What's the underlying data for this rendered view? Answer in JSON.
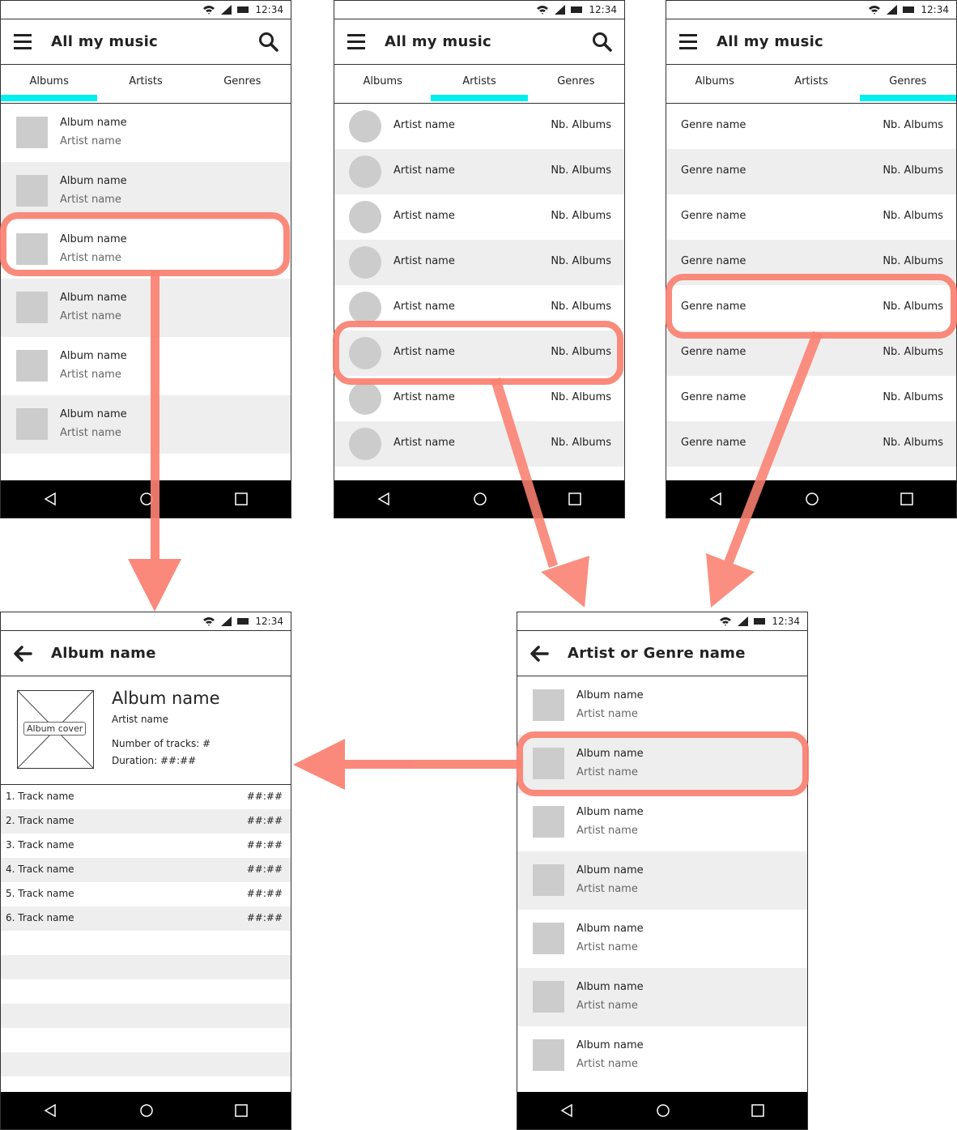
{
  "status": {
    "time": "12:34"
  },
  "screen_albums": {
    "title": "All my music",
    "tabs": [
      "Albums",
      "Artists",
      "Genres"
    ],
    "items": [
      {
        "album": "Album name",
        "artist": "Artist name"
      },
      {
        "album": "Album name",
        "artist": "Artist name"
      },
      {
        "album": "Album name",
        "artist": "Artist name"
      },
      {
        "album": "Album name",
        "artist": "Artist name"
      },
      {
        "album": "Album name",
        "artist": "Artist name"
      },
      {
        "album": "Album name",
        "artist": "Artist name"
      }
    ]
  },
  "screen_artists": {
    "title": "All my music",
    "tabs": [
      "Albums",
      "Artists",
      "Genres"
    ],
    "items": [
      {
        "name": "Artist name",
        "count": "Nb. Albums"
      },
      {
        "name": "Artist name",
        "count": "Nb. Albums"
      },
      {
        "name": "Artist name",
        "count": "Nb. Albums"
      },
      {
        "name": "Artist name",
        "count": "Nb. Albums"
      },
      {
        "name": "Artist name",
        "count": "Nb. Albums"
      },
      {
        "name": "Artist name",
        "count": "Nb. Albums"
      },
      {
        "name": "Artist name",
        "count": "Nb. Albums"
      },
      {
        "name": "Artist name",
        "count": "Nb. Albums"
      }
    ]
  },
  "screen_genres": {
    "title": "All my music",
    "tabs": [
      "Albums",
      "Artists",
      "Genres"
    ],
    "items": [
      {
        "name": "Genre name",
        "count": "Nb. Albums"
      },
      {
        "name": "Genre name",
        "count": "Nb. Albums"
      },
      {
        "name": "Genre name",
        "count": "Nb. Albums"
      },
      {
        "name": "Genre name",
        "count": "Nb. Albums"
      },
      {
        "name": "Genre name",
        "count": "Nb. Albums"
      },
      {
        "name": "Genre name",
        "count": "Nb. Albums"
      },
      {
        "name": "Genre name",
        "count": "Nb. Albums"
      },
      {
        "name": "Genre name",
        "count": "Nb. Albums"
      }
    ]
  },
  "screen_album_detail": {
    "title": "Album name",
    "cover_label": "Album cover",
    "album_name": "Album name",
    "artist_name": "Artist name",
    "tracks_count": "Number of tracks: #",
    "duration": "Duration: ##:##",
    "tracks": [
      {
        "label": "1.  Track name",
        "duration": "##:##"
      },
      {
        "label": "2. Track name",
        "duration": "##:##"
      },
      {
        "label": "3. Track name",
        "duration": "##:##"
      },
      {
        "label": "4. Track name",
        "duration": "##:##"
      },
      {
        "label": "5. Track name",
        "duration": "##:##"
      },
      {
        "label": "6. Track name",
        "duration": "##:##"
      }
    ]
  },
  "screen_artist_genre": {
    "title": "Artist or Genre name",
    "items": [
      {
        "album": "Album name",
        "artist": "Artist name"
      },
      {
        "album": "Album name",
        "artist": "Artist name"
      },
      {
        "album": "Album name",
        "artist": "Artist name"
      },
      {
        "album": "Album name",
        "artist": "Artist name"
      },
      {
        "album": "Album name",
        "artist": "Artist name"
      },
      {
        "album": "Album name",
        "artist": "Artist name"
      },
      {
        "album": "Album name",
        "artist": "Artist name"
      }
    ]
  },
  "colors": {
    "highlight": "#fa8070",
    "tab_indicator": "#00f0ee",
    "row_alt": "#eeeeee",
    "placeholder": "#cccccc"
  }
}
